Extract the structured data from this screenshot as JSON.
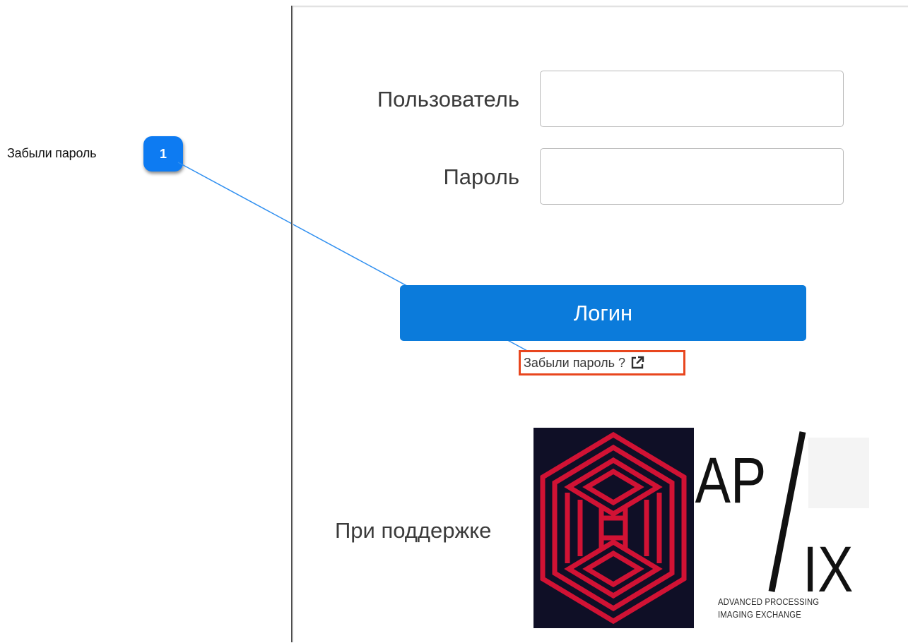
{
  "annotation": {
    "label": "Забыли пароль",
    "badge_number": "1",
    "badge_color": "#0d7bf2",
    "highlight_color": "#e8461e"
  },
  "login_form": {
    "username_label": "Пользователь",
    "username_value": "",
    "password_label": "Пароль",
    "password_value": "",
    "login_button_label": "Логин",
    "forgot_password_link": "Забыли пароль ?",
    "forgot_password_icon": "external-link-icon",
    "accent_color": "#0b7bdb"
  },
  "footer": {
    "support_label": "При поддержке",
    "logo": {
      "wordmark_top": "AP",
      "wordmark_bottom": "IX",
      "caption_line1": "ADVANCED PROCESSING",
      "caption_line2": "IMAGING EXCHANGE",
      "mark_colors": {
        "background": "#0f0f26",
        "stroke": "#d11234"
      }
    }
  }
}
